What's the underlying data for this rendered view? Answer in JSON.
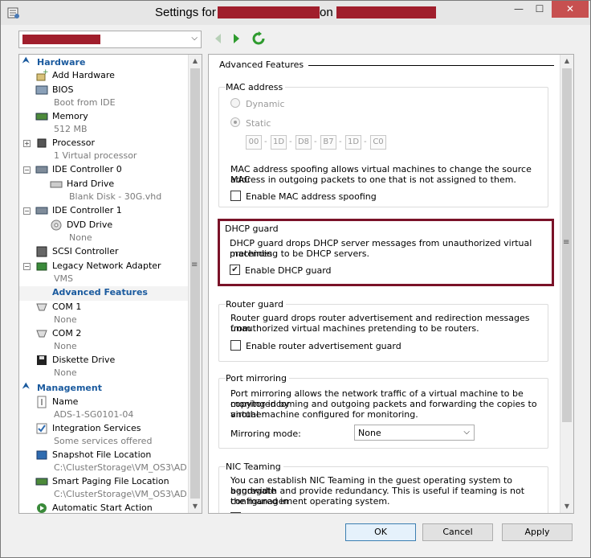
{
  "window": {
    "title_prefix": "Settings for",
    "title_mid": "on",
    "minimize": "—",
    "maximize": "☐",
    "close": "✕"
  },
  "toolbar": {
    "back_label": "◀",
    "forward_label": "▶",
    "refresh_label": "⟳",
    "dropdown_arrow": "⌵"
  },
  "sidebar": {
    "hardware_header": "Hardware",
    "management_header": "Management",
    "items": [
      {
        "label": "Add Hardware",
        "sub": ""
      },
      {
        "label": "BIOS",
        "sub": "Boot from IDE"
      },
      {
        "label": "Memory",
        "sub": "512 MB"
      },
      {
        "label": "Processor",
        "sub": "1 Virtual processor"
      },
      {
        "label": "IDE Controller 0",
        "sub": ""
      },
      {
        "label": "Hard Drive",
        "sub": "Blank Disk - 30G.vhd"
      },
      {
        "label": "IDE Controller 1",
        "sub": ""
      },
      {
        "label": "DVD Drive",
        "sub": "None"
      },
      {
        "label": "SCSI Controller",
        "sub": ""
      },
      {
        "label": "Legacy Network Adapter",
        "sub": "VMS"
      },
      {
        "label": "Advanced Features",
        "sub": ""
      },
      {
        "label": "COM 1",
        "sub": "None"
      },
      {
        "label": "COM 2",
        "sub": "None"
      },
      {
        "label": "Diskette Drive",
        "sub": "None"
      },
      {
        "label": "Name",
        "sub": "ADS-1-SG0101-04"
      },
      {
        "label": "Integration Services",
        "sub": "Some services offered"
      },
      {
        "label": "Snapshot File Location",
        "sub": "C:\\ClusterStorage\\VM_OS3\\AD..."
      },
      {
        "label": "Smart Paging File Location",
        "sub": "C:\\ClusterStorage\\VM_OS3\\AD..."
      },
      {
        "label": "Automatic Start Action",
        "sub": ""
      }
    ]
  },
  "main": {
    "title": "Advanced Features",
    "mac": {
      "title": "MAC address",
      "dynamic_label": "Dynamic",
      "static_label": "Static",
      "octets": [
        "00",
        "1D",
        "D8",
        "B7",
        "1D",
        "C0"
      ],
      "spoof_desc_1": "MAC address spoofing allows virtual machines to change the source MAC",
      "spoof_desc_2": "address in outgoing packets to one that is not assigned to them.",
      "spoof_checkbox": "Enable MAC address spoofing",
      "spoof_checked": false
    },
    "dhcp": {
      "title": "DHCP guard",
      "desc_1": "DHCP guard drops DHCP server messages from unauthorized virtual machines",
      "desc_2": "pretending to be DHCP servers.",
      "checkbox": "Enable DHCP guard",
      "checked": true,
      "check_mark": "✔"
    },
    "router": {
      "title": "Router guard",
      "desc_1": "Router guard drops router advertisement and redirection messages from",
      "desc_2": "unauthorized virtual machines pretending to be routers.",
      "checkbox": "Enable router advertisement guard",
      "checked": false
    },
    "mirror": {
      "title": "Port mirroring",
      "desc_1": "Port mirroring allows the network traffic of a virtual machine to be monitored by",
      "desc_2": "copying incoming and outgoing packets and forwarding the copies to another",
      "desc_3": "virtual machine configured for monitoring.",
      "mode_label": "Mirroring mode:",
      "mode_value": "None"
    },
    "teaming": {
      "title": "NIC Teaming",
      "desc_1": "You can establish NIC Teaming in the guest operating system to aggregate",
      "desc_2": "bandwidth and provide redundancy. This is useful if teaming is not configured in",
      "desc_3": "the management operating system."
    }
  },
  "buttons": {
    "ok": "OK",
    "cancel": "Cancel",
    "apply": "Apply"
  },
  "colors": {
    "accent": "#1a5a9e",
    "highlight_border": "#7a1228",
    "redaction": "#a01e2c"
  }
}
